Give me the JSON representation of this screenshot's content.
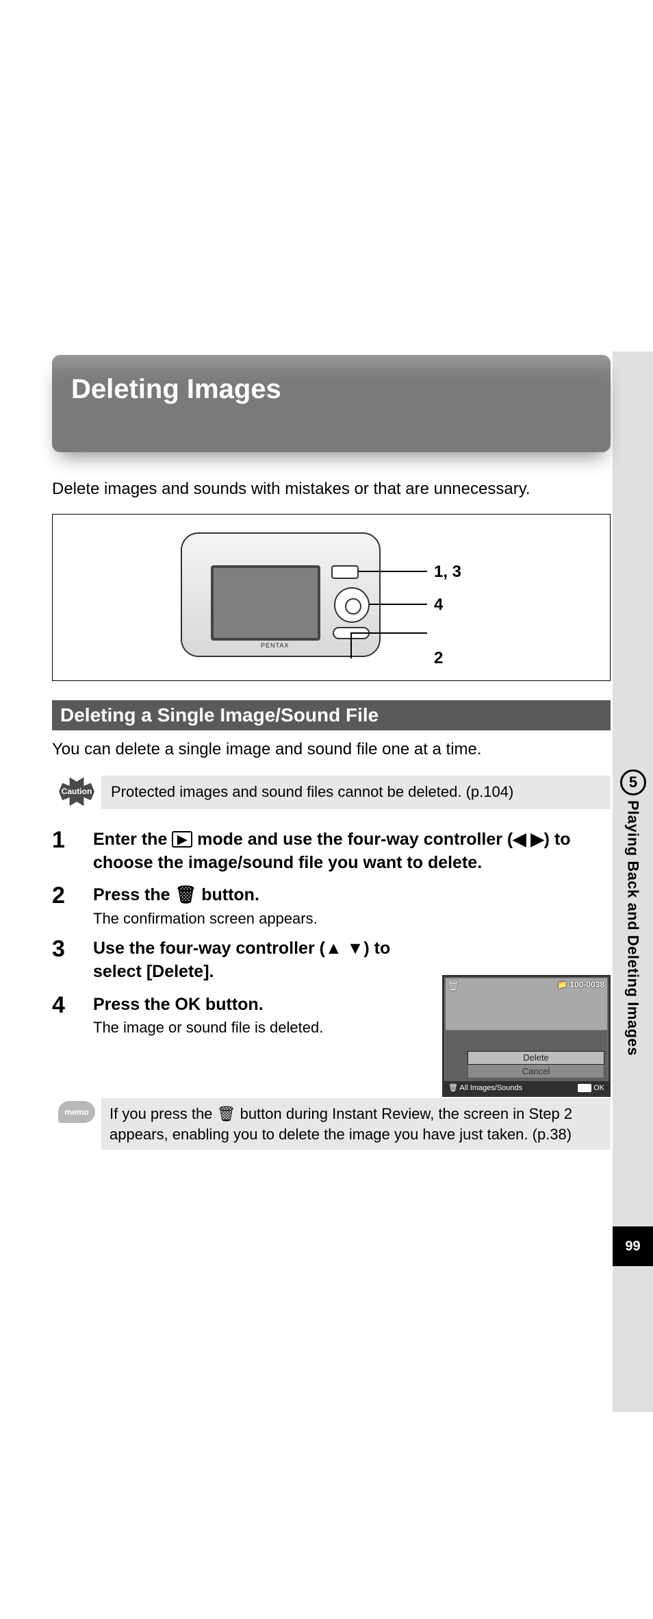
{
  "sidebar": {
    "chapter_num": "5",
    "chapter_title": "Playing Back and Deleting Images",
    "page_num": "99"
  },
  "title": "Deleting Images",
  "intro": "Delete images and sounds with mistakes or that are unnecessary.",
  "figure": {
    "brand": "PENTAX",
    "callout1": "1, 3",
    "callout2": "4",
    "callout3": "2"
  },
  "subhead": "Deleting a Single Image/Sound File",
  "subintro": "You can delete a single image and sound file one at a time.",
  "caution": {
    "label": "Caution",
    "text": "Protected images and sound files cannot be deleted. (p.104)"
  },
  "steps": {
    "s1": {
      "num": "1",
      "t1": "Enter the ",
      "t2": " mode and use the four-way controller (",
      "t3": ") to choose the image/sound file you want to delete.",
      "play_glyph": "▶",
      "arrows_lr": "◀ ▶"
    },
    "s2": {
      "num": "2",
      "title_a": "Press the ",
      "title_b": " button.",
      "trash": "🗑",
      "sub": "The confirmation screen appears."
    },
    "s3": {
      "num": "3",
      "title_a": "Use the four-way controller (",
      "title_b": ") to select [Delete].",
      "arrows_ud": "▲ ▼"
    },
    "s4": {
      "num": "4",
      "title_a": "Press the ",
      "ok": "OK",
      "title_b": " button.",
      "sub": "The image or sound file is deleted."
    }
  },
  "lcd": {
    "folder": "100-0038",
    "opt1": "Delete",
    "opt2": "Cancel",
    "bar_left": "All Images/Sounds",
    "bar_ok_box": "OK",
    "bar_ok": "OK"
  },
  "memo": {
    "label": "memo",
    "t1": "If you press the ",
    "trash": "🗑",
    "t2": " button during Instant Review, the screen in Step 2 appears, enabling you to delete the image you have just taken. (p.38)"
  }
}
